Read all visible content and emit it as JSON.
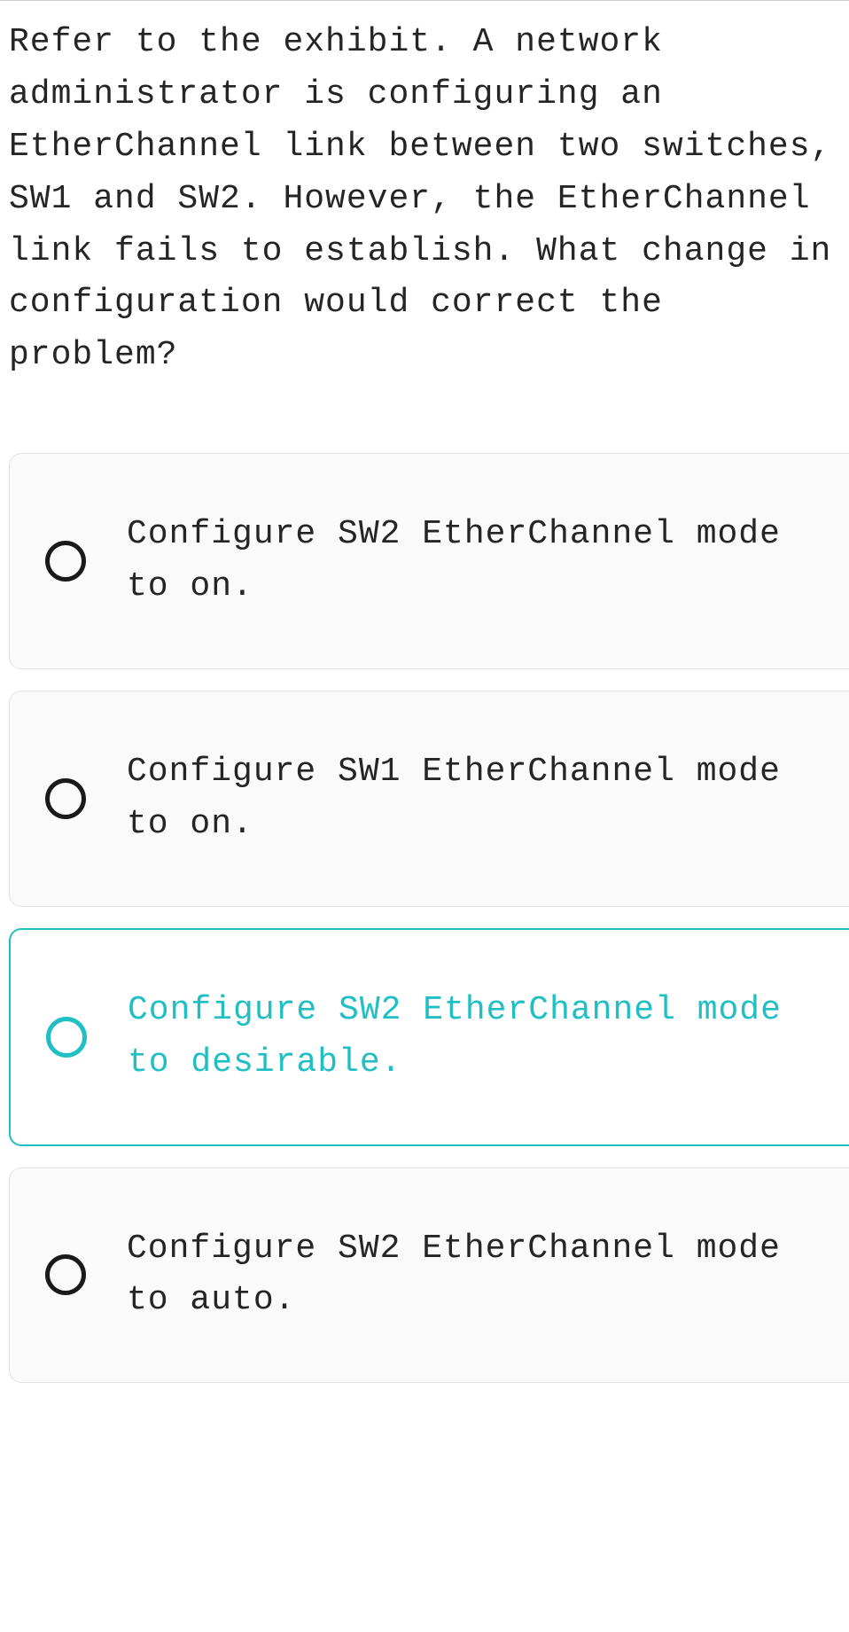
{
  "question": {
    "text": "Refer to the exhibit. A network administrator is configuring an EtherChannel link between two switches, SW1 and SW2. However, the EtherChannel link fails to establish. What change in configuration would correct the problem?"
  },
  "options": [
    {
      "label": "Configure SW2 EtherChannel mode to on.",
      "selected": false
    },
    {
      "label": "Configure SW1 EtherChannel mode to on.",
      "selected": false
    },
    {
      "label": "Configure SW2 EtherChannel mode to desirable.",
      "selected": true
    },
    {
      "label": "Configure SW2 EtherChannel mode to auto.",
      "selected": false
    }
  ]
}
